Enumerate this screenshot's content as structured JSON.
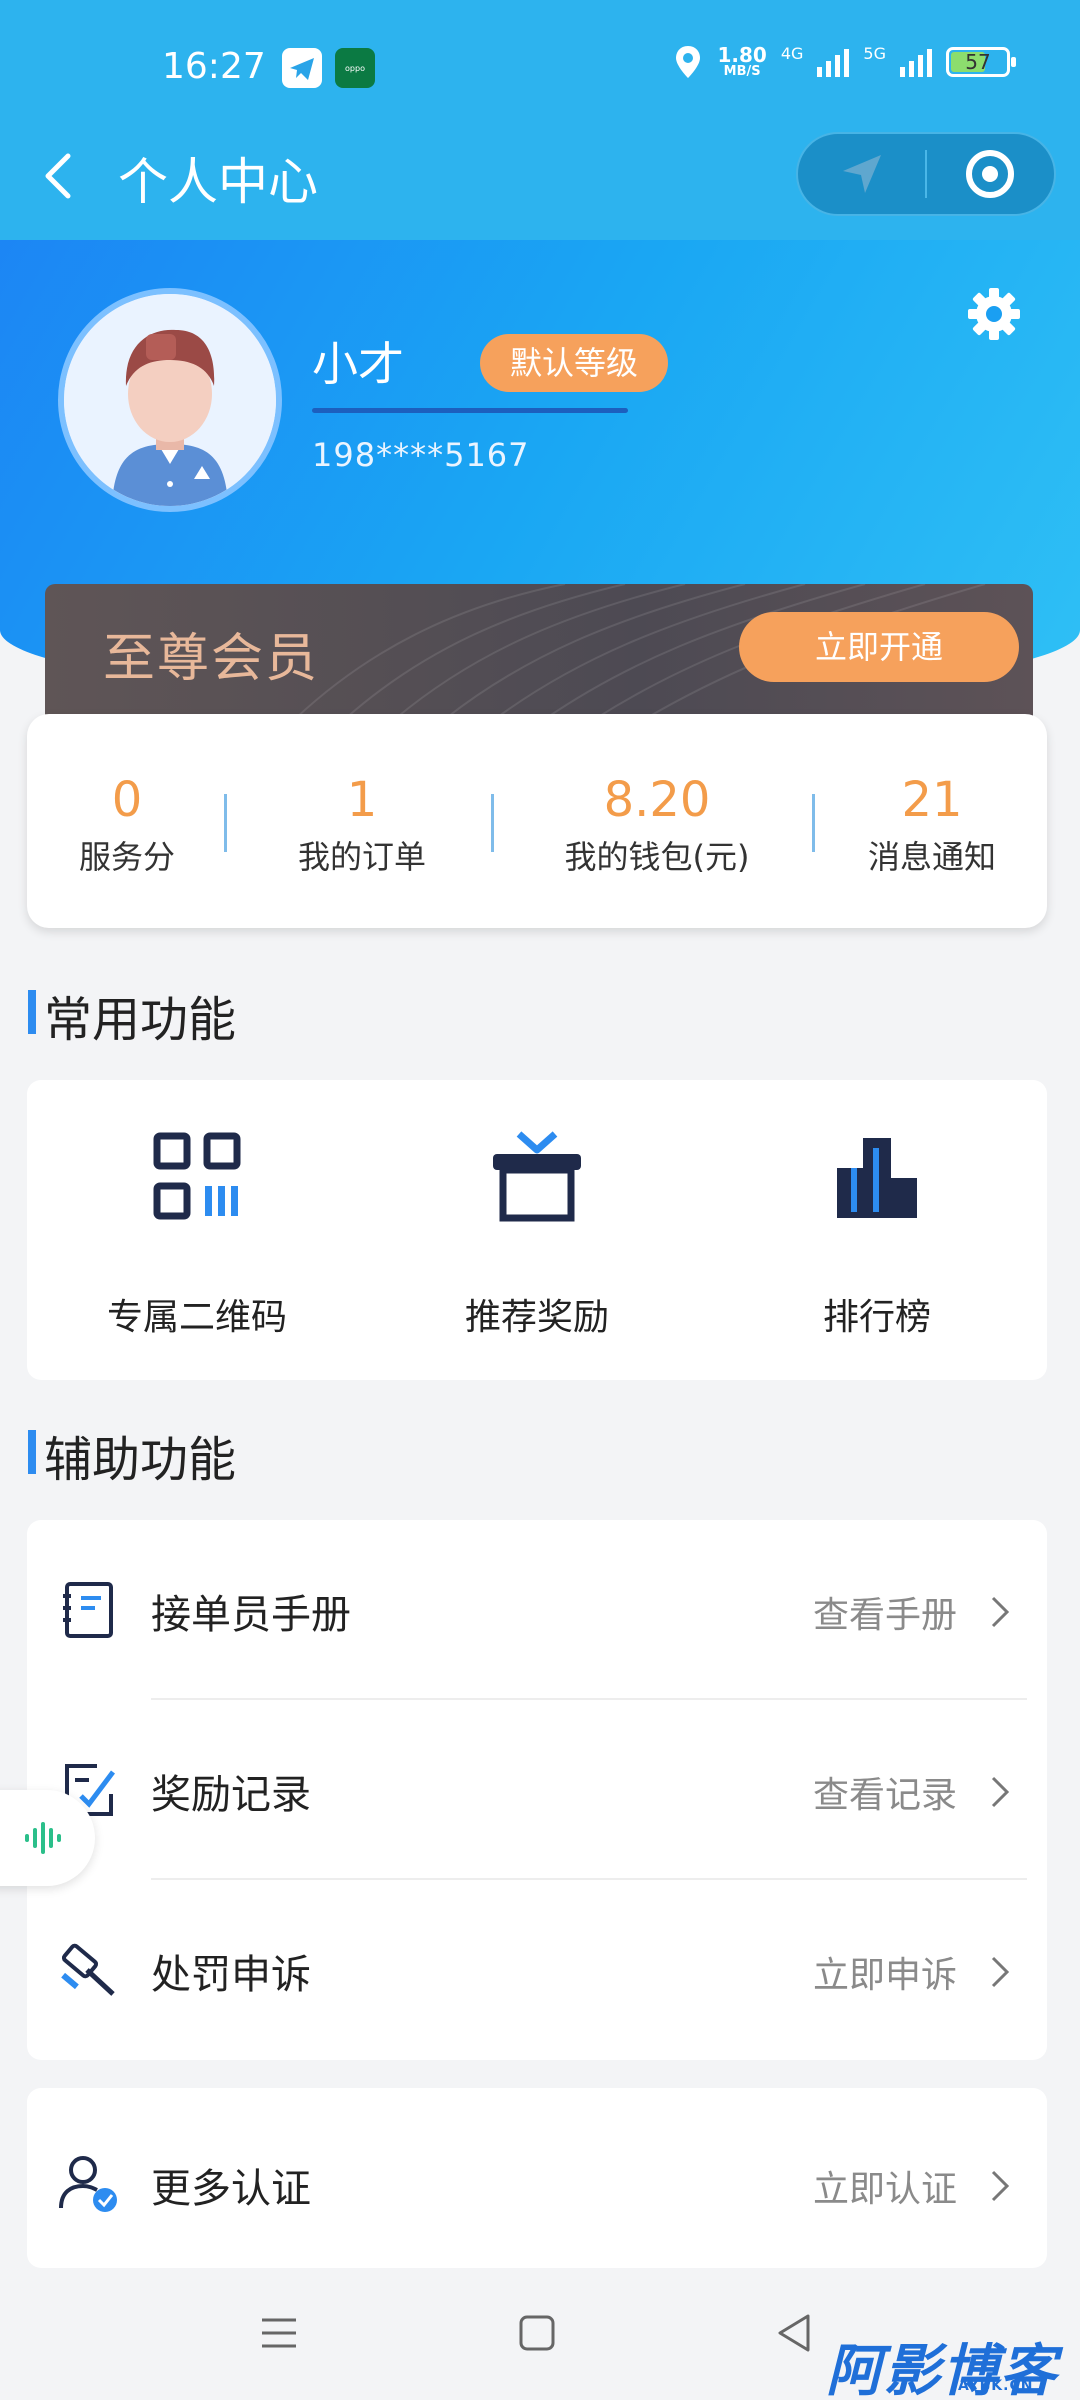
{
  "status_bar": {
    "time": "16:27",
    "net_speed_value": "1.80",
    "net_speed_unit": "MB/S",
    "signal_1_label": "4G",
    "signal_2_label": "5G",
    "battery": "57",
    "app_badge_2": "oppo"
  },
  "header": {
    "title": "个人中心"
  },
  "profile": {
    "name": "小才",
    "level": "默认等级",
    "phone": "198****5167"
  },
  "vip": {
    "title": "至尊会员",
    "button": "立即开通"
  },
  "stats": [
    {
      "value": "0",
      "label": "服务分"
    },
    {
      "value": "1",
      "label": "我的订单"
    },
    {
      "value": "8.20",
      "label": "我的钱包(元)"
    },
    {
      "value": "21",
      "label": "消息通知"
    }
  ],
  "common_functions": {
    "title": "常用功能",
    "items": [
      {
        "label": "专属二维码",
        "icon": "qr-code-icon"
      },
      {
        "label": "推荐奖励",
        "icon": "gift-icon"
      },
      {
        "label": "排行榜",
        "icon": "ranking-icon"
      }
    ]
  },
  "aux_functions": {
    "title": "辅助功能",
    "items": [
      {
        "title": "接单员手册",
        "action": "查看手册",
        "icon": "handbook-icon"
      },
      {
        "title": "奖励记录",
        "action": "查看记录",
        "icon": "reward-record-icon"
      },
      {
        "title": "处罚申诉",
        "action": "立即申诉",
        "icon": "gavel-icon"
      }
    ]
  },
  "more": {
    "title": "更多认证",
    "action": "立即认证",
    "icon": "user-verify-icon"
  },
  "watermark": {
    "main": "阿影博客",
    "sub": "AYBK.CN"
  },
  "colors": {
    "primary_blue": "#1c8ef5",
    "accent_orange": "#f6a15c",
    "number_orange": "#f39c4a",
    "vip_gold": "#e8b89a"
  }
}
